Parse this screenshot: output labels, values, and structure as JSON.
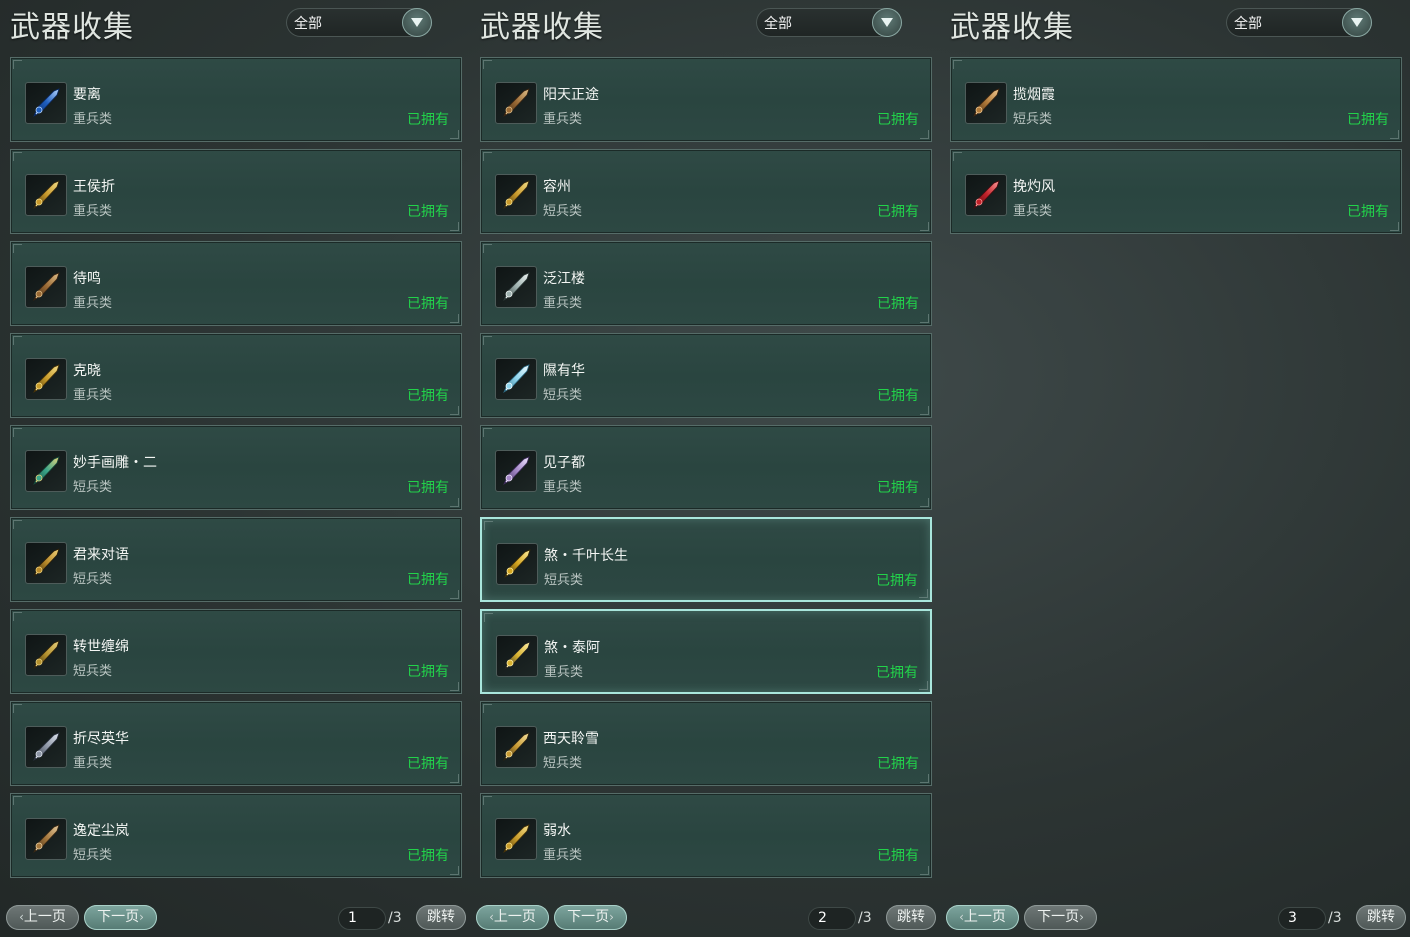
{
  "colors": {
    "owned": "#22d24a",
    "accent_selected": "#a9e6dc"
  },
  "panels": [
    {
      "title": "武器收集",
      "filter": "全部",
      "page": "1",
      "total": "/3",
      "prev_label": "上一页",
      "next_label": "下一页",
      "jump_label": "跳转",
      "active_nav": "next",
      "items": [
        {
          "name": "要离",
          "type": "重兵类",
          "status": "已拥有",
          "icon": "blue-crescent-blade-icon",
          "selected": false
        },
        {
          "name": "王侯折",
          "type": "重兵类",
          "status": "已拥有",
          "icon": "gold-dagger-icon",
          "selected": false
        },
        {
          "name": "待鸣",
          "type": "重兵类",
          "status": "已拥有",
          "icon": "bronze-blade-icon",
          "selected": false
        },
        {
          "name": "克晓",
          "type": "重兵类",
          "status": "已拥有",
          "icon": "gold-blade-icon",
          "selected": false
        },
        {
          "name": "妙手画雕・二",
          "type": "短兵类",
          "status": "已拥有",
          "icon": "jade-dagger-icon",
          "selected": false
        },
        {
          "name": "君来对语",
          "type": "短兵类",
          "status": "已拥有",
          "icon": "gold-knife-icon",
          "selected": false
        },
        {
          "name": "转世缠绵",
          "type": "短兵类",
          "status": "已拥有",
          "icon": "twin-knife-icon",
          "selected": false
        },
        {
          "name": "折尽英华",
          "type": "重兵类",
          "status": "已拥有",
          "icon": "silver-spear-blade-icon",
          "selected": false
        },
        {
          "name": "逸定尘岚",
          "type": "短兵类",
          "status": "已拥有",
          "icon": "bronze-dagger-icon",
          "selected": false
        }
      ]
    },
    {
      "title": "武器收集",
      "filter": "全部",
      "page": "2",
      "total": "/3",
      "prev_label": "上一页",
      "next_label": "下一页",
      "jump_label": "跳转",
      "active_nav": "both",
      "items": [
        {
          "name": "阳天正途",
          "type": "重兵类",
          "status": "已拥有",
          "icon": "bronze-blade-icon",
          "selected": false
        },
        {
          "name": "容州",
          "type": "短兵类",
          "status": "已拥有",
          "icon": "gold-dagger-icon",
          "selected": false
        },
        {
          "name": "泛江楼",
          "type": "重兵类",
          "status": "已拥有",
          "icon": "silver-blade-icon",
          "selected": false
        },
        {
          "name": "隰有华",
          "type": "短兵类",
          "status": "已拥有",
          "icon": "crystal-dagger-icon",
          "selected": false
        },
        {
          "name": "见子都",
          "type": "重兵类",
          "status": "已拥有",
          "icon": "violet-crystal-blade-icon",
          "selected": false
        },
        {
          "name": "煞・千叶长生",
          "type": "短兵类",
          "status": "已拥有",
          "icon": "gold-ring-dagger-icon",
          "selected": true
        },
        {
          "name": "煞・泰阿",
          "type": "重兵类",
          "status": "已拥有",
          "icon": "gold-swirl-blade-icon",
          "selected": true
        },
        {
          "name": "西天聆雪",
          "type": "短兵类",
          "status": "已拥有",
          "icon": "gold-spear-icon",
          "selected": false
        },
        {
          "name": "弱水",
          "type": "重兵类",
          "status": "已拥有",
          "icon": "gold-blade-icon",
          "selected": false
        }
      ]
    },
    {
      "title": "武器收集",
      "filter": "全部",
      "page": "3",
      "total": "/3",
      "prev_label": "上一页",
      "next_label": "下一页",
      "jump_label": "跳转",
      "active_nav": "prev",
      "items": [
        {
          "name": "揽烟霞",
          "type": "短兵类",
          "status": "已拥有",
          "icon": "bronze-cross-dagger-icon",
          "selected": false
        },
        {
          "name": "挽灼风",
          "type": "重兵类",
          "status": "已拥有",
          "icon": "red-crystal-blade-icon",
          "selected": false
        }
      ]
    }
  ]
}
